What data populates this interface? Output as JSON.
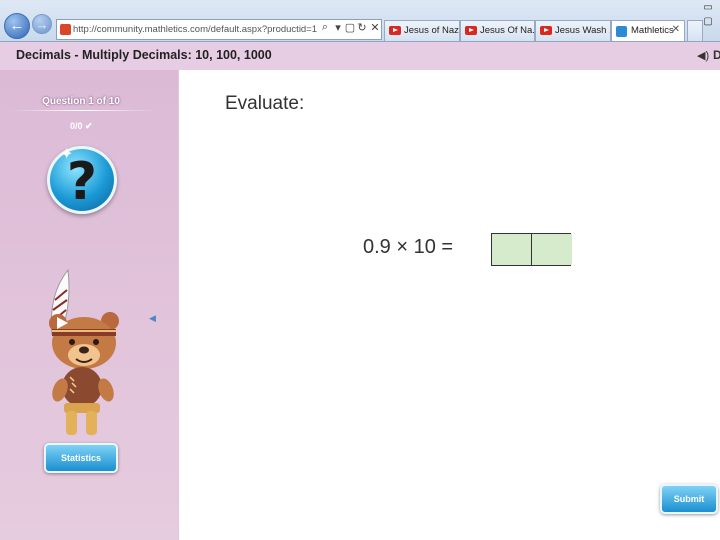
{
  "browser": {
    "url": "http://community.mathletics.com/default.aspx?productid=1",
    "tabs": [
      {
        "label": "Jesus of Naz..."
      },
      {
        "label": "Jesus Of Na..."
      },
      {
        "label": "Jesus Wash ..."
      },
      {
        "label": "Mathletics",
        "active": true
      }
    ]
  },
  "header": {
    "title": "Decimals - Multiply Decimals: 10, 100, 1000",
    "right_letter": "D"
  },
  "sidebar": {
    "question_counter": "Question 1 of 10",
    "status": "0/0 ✔",
    "help_symbol": "?",
    "statistics_label": "Statistics"
  },
  "question": {
    "instruction": "Evaluate:",
    "expression": "0.9 × 10 =",
    "answer_digits": [
      "",
      ""
    ]
  },
  "actions": {
    "submit_label": "Submit"
  },
  "colors": {
    "accent_blue": "#1a8fd0",
    "answer_box": "#d6ebcb",
    "sidebar_pink": "#e3c6de"
  }
}
